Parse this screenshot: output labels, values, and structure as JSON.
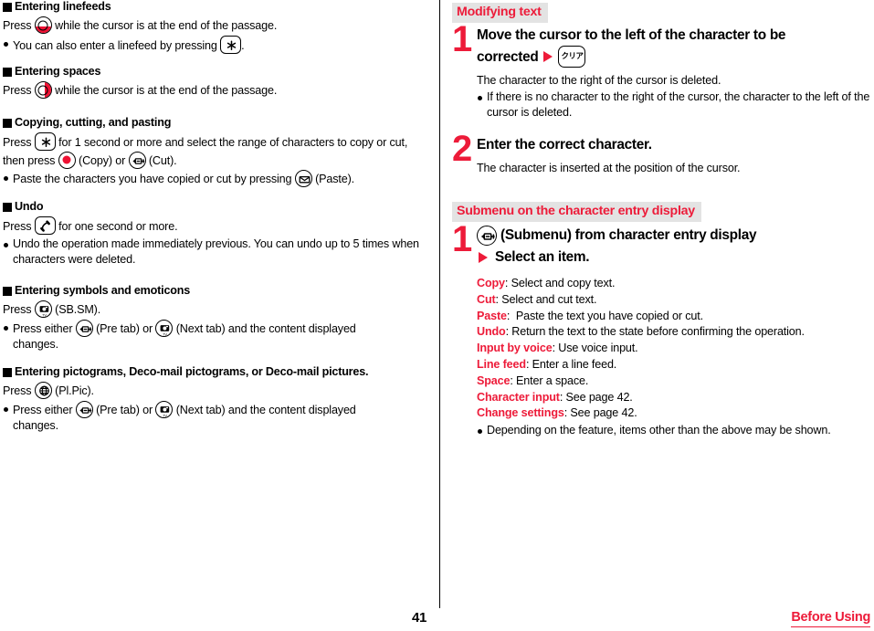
{
  "page": {
    "number": "41",
    "running_title": "Before Using",
    "accent_color": "#ed1b39",
    "band_bg_color": "#e3e3e3"
  },
  "left_column": {
    "sections": [
      {
        "heading": "Entering linefeeds",
        "lines": [
          {
            "kind": "para",
            "pre": "Press",
            "icon": "nav-key-down-icon",
            "post": "while the cursor is at the end of the passage."
          },
          {
            "kind": "bullet",
            "pre": "You can also enter a linefeed by pressing",
            "icon": "asterisk-key-icon",
            "post": "."
          }
        ]
      },
      {
        "heading": "Entering spaces",
        "lines": [
          {
            "kind": "para",
            "pre": "Press",
            "icon": "nav-key-right-icon",
            "post": "while the cursor is at the end of the passage."
          }
        ]
      },
      {
        "heading": "Copying, cutting, and pasting",
        "lines": [
          {
            "kind": "para",
            "pre": "Press",
            "icon": "asterisk-key-icon",
            "post": "for 1 second or more and select the range of characters to copy or cut, then press",
            "icon2": "select-key-icon",
            "mid2": "(Copy) or",
            "icon3": "submenu-key-icon",
            "post3": "(Cut)."
          },
          {
            "kind": "bullet",
            "pre": "Paste the characters you have copied or cut by pressing",
            "icon": "mail-key-icon",
            "post": "(Paste)."
          }
        ]
      },
      {
        "heading": "Undo",
        "lines": [
          {
            "kind": "para",
            "pre": "Press",
            "icon": "call-key-icon",
            "post": "for one second or more."
          },
          {
            "kind": "bullet",
            "pre": "Undo the operation made immediately previous. You can undo up to 5 times when characters were deleted."
          }
        ]
      },
      {
        "heading": "Entering symbols and emoticons",
        "lines": [
          {
            "kind": "para",
            "pre": "Press",
            "icon": "camera-tv-key-icon",
            "post": "(SB.SM)."
          },
          {
            "kind": "bullet",
            "pre": "Press either",
            "icon": "submenu-key-icon",
            "mid": "(Pre tab) or",
            "icon2": "camera-tv-key-icon",
            "post": "(Next tab) and the content displayed changes."
          }
        ]
      },
      {
        "heading": "Entering pictograms, Deco-mail pictograms, or Deco-mail pictures.",
        "lines": [
          {
            "kind": "para",
            "pre": "Press",
            "icon": "globe-key-icon",
            "post": "(Pl.Pic)."
          },
          {
            "kind": "bullet",
            "pre": "Press either",
            "icon": "submenu-key-icon",
            "mid": "(Pre tab) or",
            "icon2": "camera-tv-key-icon",
            "post": "(Next tab) and the content displayed changes."
          }
        ]
      }
    ]
  },
  "right_column": {
    "section_modifying": {
      "band_label": "Modifying text",
      "steps": [
        {
          "number": "1",
          "title_part1": "Move the cursor to the left of the character to be",
          "title_part2": "corrected",
          "key_icon": "clear-key-icon",
          "key_icon_label": "クリア",
          "body": "The character to the right of the cursor is deleted.",
          "bullet": "If there is no character to the right of the cursor, the character to the left of the cursor is deleted."
        },
        {
          "number": "2",
          "title_part1": "Enter the correct character.",
          "body": "The character is inserted at the position of the cursor."
        }
      ]
    },
    "section_submenu": {
      "band_label": "Submenu on the character entry display",
      "step": {
        "number": "1",
        "key_icon": "submenu-key-icon",
        "key_icon_label": "メニュー",
        "title_part1": "(Submenu) from character entry display",
        "title_part2": "Select an item."
      },
      "menu_items": [
        {
          "term": "Copy",
          "desc": ": Select and copy text."
        },
        {
          "term": "Cut",
          "desc": ": Select and cut text."
        },
        {
          "term": "Paste",
          "desc": ":  Paste the text you have copied or cut."
        },
        {
          "term": "Undo",
          "desc": ": Return the text to the state before confirming the operation."
        },
        {
          "term": "Input by voice",
          "desc": ": Use voice input."
        },
        {
          "term": "Line feed",
          "desc": ": Enter a line feed."
        },
        {
          "term": "Space",
          "desc": ": Enter a space."
        },
        {
          "term": "Character input",
          "desc": ": See page 42."
        },
        {
          "term": "Change settings",
          "desc": ": See page 42."
        }
      ],
      "note": "Depending on the feature, items other than the above may be shown."
    }
  }
}
